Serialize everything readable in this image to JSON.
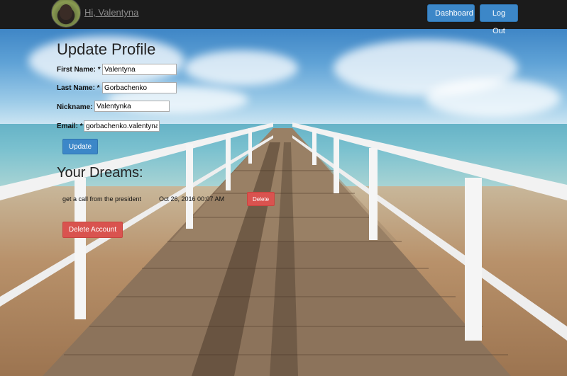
{
  "nav": {
    "greeting": "Hi, Valentyna",
    "dashboard_label": "Dashboard",
    "logout_label": "Log Out"
  },
  "profile": {
    "title": "Update Profile",
    "first_name": {
      "label": "First Name: *",
      "value": "Valentyna"
    },
    "last_name": {
      "label": "Last Name: *",
      "value": "Gorbachenko"
    },
    "nickname": {
      "label": "Nickname:",
      "value": "Valentynka"
    },
    "email": {
      "label": "Email: *",
      "value": "gorbachenko.valentyna"
    },
    "update_label": "Update"
  },
  "dreams": {
    "title": "Your Dreams:",
    "items": [
      {
        "text": "get a call from the president",
        "date": "Oct 26, 2016 00:07 AM",
        "delete_label": "Delete"
      }
    ]
  },
  "account": {
    "delete_label": "Delete Account"
  },
  "colors": {
    "navbar": "#1b1b1b",
    "primary": "#3c87c8",
    "danger": "#d9534f"
  }
}
